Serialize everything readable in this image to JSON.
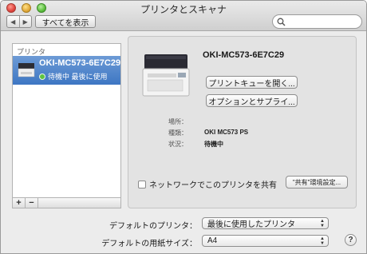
{
  "window": {
    "title": "プリンタとスキャナ"
  },
  "toolbar": {
    "back": "◀",
    "forward": "▶",
    "show_all": "すべてを表示",
    "search_placeholder": ""
  },
  "sidebar": {
    "header": "プリンタ",
    "items": [
      {
        "name": "OKI-MC573-6E7C29",
        "status": "待機中 最後に使用",
        "selected": true
      }
    ],
    "add": "+",
    "remove": "−"
  },
  "detail": {
    "printer_name": "OKI-MC573-6E7C29",
    "open_queue": "プリントキューを開く...",
    "options_supplies": "オプションとサプライ...",
    "location_label": "場所：",
    "location_value": "",
    "kind_label": "種類：",
    "kind_value": "OKI MC573 PS",
    "status_label": "状況：",
    "status_value": "待機中",
    "share_label": "ネットワークでこのプリンタを共有",
    "sharing_prefs": "\"共有\"環境設定..."
  },
  "footer": {
    "default_printer_label": "デフォルトのプリンタ：",
    "default_printer_value": "最後に使用したプリンタ",
    "default_paper_label": "デフォルトの用紙サイズ：",
    "default_paper_value": "A4",
    "help": "?"
  },
  "colors": {
    "selection": "#4a7fc9",
    "status_green": "#5dc441"
  }
}
